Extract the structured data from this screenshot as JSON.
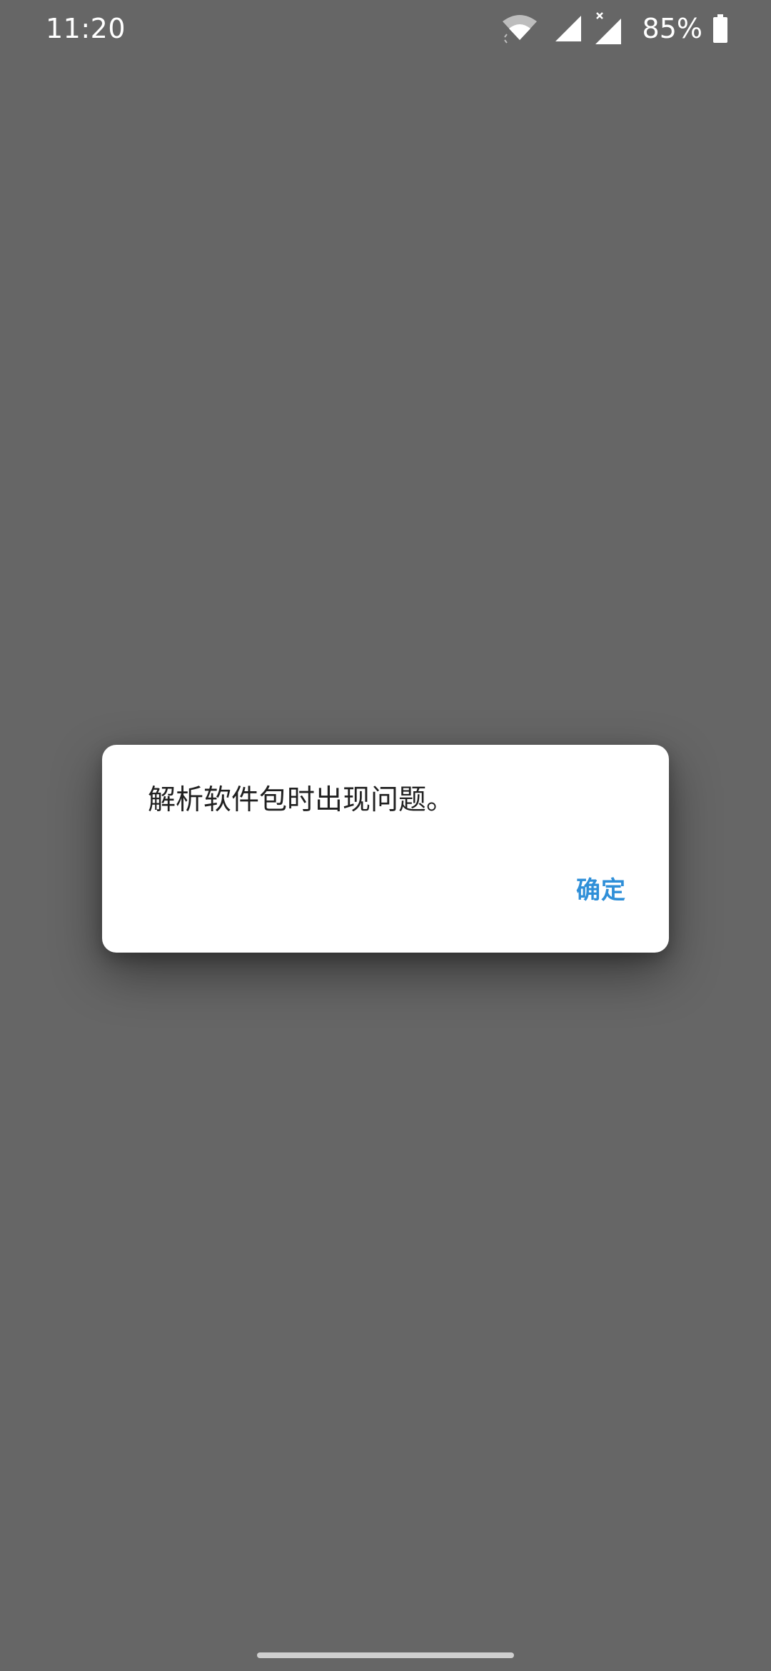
{
  "status_bar": {
    "time": "11:20",
    "battery_percent": "85%",
    "icons": [
      "wifi-icon",
      "cellular-signal-icon",
      "cellular-signal-no-service-icon",
      "battery-icon"
    ]
  },
  "dialog": {
    "message": "解析软件包时出现问题。",
    "ok_label": "确定"
  },
  "colors": {
    "background_dim": "#666666",
    "dialog_bg": "#ffffff",
    "accent": "#2f8fd8",
    "text_primary": "#202020"
  }
}
